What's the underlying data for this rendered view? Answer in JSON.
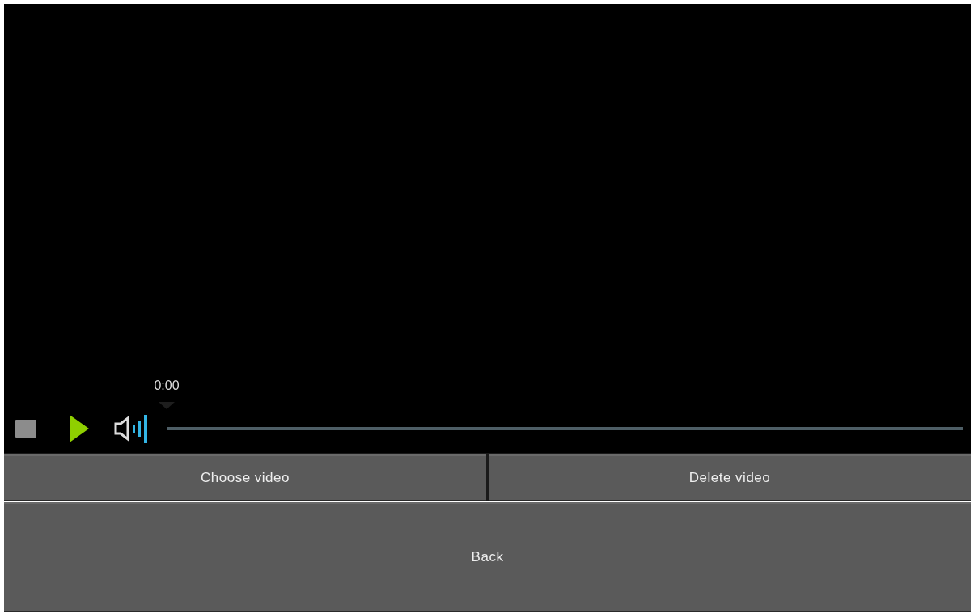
{
  "player": {
    "time": "0:00",
    "seek": {
      "level": 0
    }
  },
  "buttons": [
    {
      "label": "Choose video"
    },
    {
      "label": "Delete video"
    }
  ],
  "back_button": {
    "label": "Back"
  }
}
